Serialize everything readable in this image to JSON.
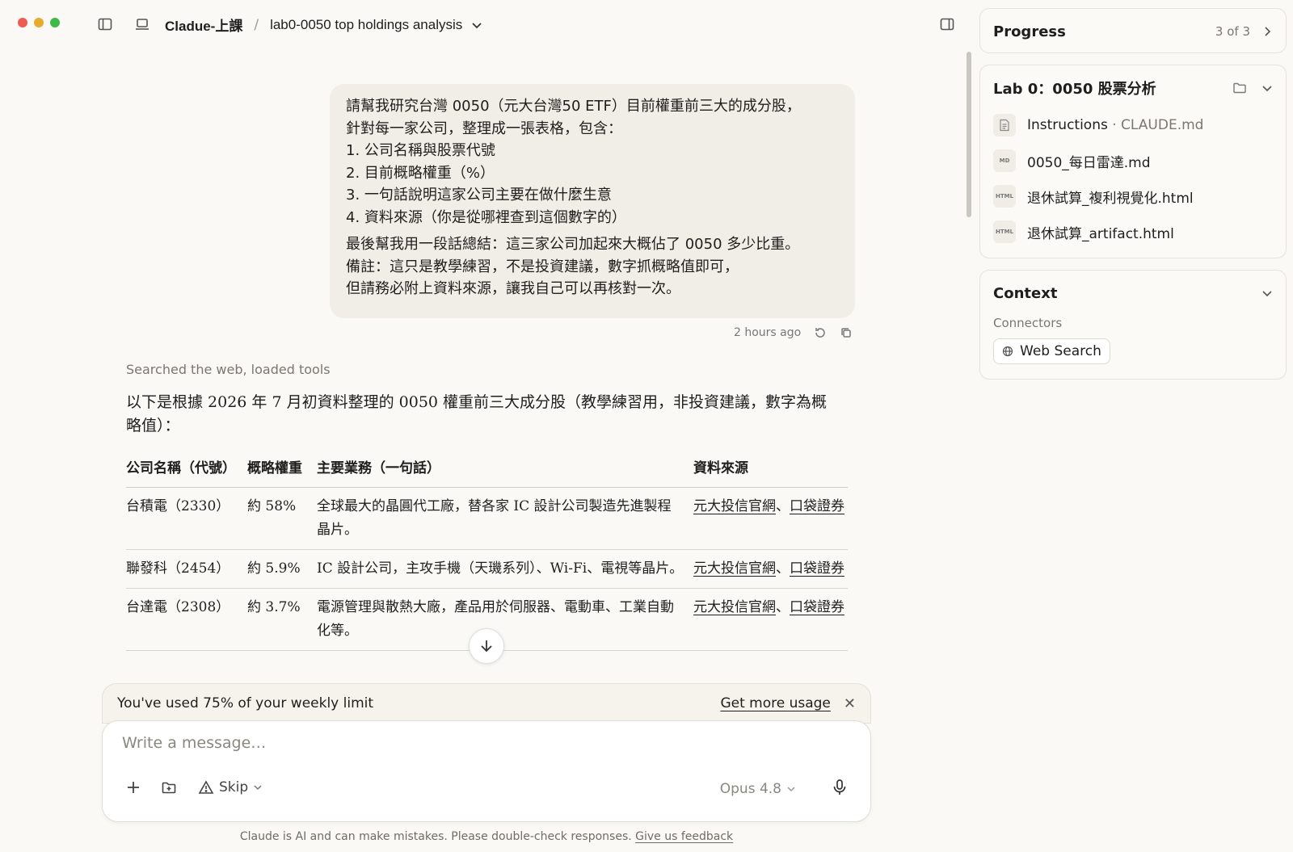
{
  "topbar": {
    "project": "Cladue-上課",
    "separator": "/",
    "chat_title": "lab0-0050 top holdings analysis"
  },
  "user_message": {
    "lines_part1": [
      "請幫我研究台灣 0050（元大台灣50 ETF）目前權重前三大的成分股，",
      "針對每一家公司，整理成一張表格，包含：",
      "1. 公司名稱與股票代號",
      "2. 目前概略權重（%）",
      "3. 一句話說明這家公司主要在做什麼生意",
      "4. 資料來源（你是從哪裡查到這個數字的）"
    ],
    "lines_part2": [
      "最後幫我用一段話總結：這三家公司加起來大概佔了 0050 多少比重。",
      "備註：這只是教學練習，不是投資建議，數字抓概略值即可，",
      "但請務必附上資料來源，讓我自己可以再核對一次。"
    ],
    "timestamp": "2 hours ago"
  },
  "assistant": {
    "tools_line": "Searched the web, loaded tools",
    "intro": "以下是根據 2026 年 7 月初資料整理的 0050 權重前三大成分股（教學練習用，非投資建議，數字為概略值）：",
    "table": {
      "headers": [
        "公司名稱（代號）",
        "概略權重",
        "主要業務（一句話）",
        "資料來源"
      ],
      "rows": [
        {
          "company": "台積電（2330）",
          "weight": "約 58%",
          "business": "全球最大的晶圓代工廠，替各家 IC 設計公司製造先進製程晶片。",
          "source_a": "元大投信官網",
          "source_sep": "、",
          "source_b": "口袋證券"
        },
        {
          "company": "聯發科（2454）",
          "weight": "約 5.9%",
          "business": "IC 設計公司，主攻手機（天璣系列）、Wi-Fi、電視等晶片。",
          "source_a": "元大投信官網",
          "source_sep": "、",
          "source_b": "口袋證券"
        },
        {
          "company": "台達電（2308）",
          "weight": "約 3.7%",
          "business": "電源管理與散熱大廠，產品用於伺服器、電動車、工業自動化等。",
          "source_a": "元大投信官網",
          "source_sep": "、",
          "source_b": "口袋證券"
        }
      ]
    }
  },
  "composer": {
    "usage_text": "You've used 75% of your weekly limit",
    "get_more": "Get more usage",
    "placeholder": "Write a message…",
    "skip_label": "Skip",
    "model": "Opus 4.8"
  },
  "disclaimer": {
    "text": "Claude is AI and can make mistakes. Please double-check responses.",
    "feedback": "Give us feedback"
  },
  "panel": {
    "progress": {
      "title": "Progress",
      "count": "3 of 3"
    },
    "lab": {
      "title": "Lab 0：0050 股票分析",
      "files": [
        {
          "name": "Instructions",
          "suffix": " · CLAUDE.md",
          "icon": "document-icon",
          "badge": ""
        },
        {
          "name": "0050_每日雷達.md",
          "suffix": "",
          "icon": "markdown-file-icon",
          "badge": "MD"
        },
        {
          "name": "退休試算_複利視覺化.html",
          "suffix": "",
          "icon": "html-file-icon",
          "badge": "HTML"
        },
        {
          "name": "退休試算_artifact.html",
          "suffix": "",
          "icon": "html-file-icon",
          "badge": "HTML"
        }
      ]
    },
    "context": {
      "title": "Context",
      "connectors_label": "Connectors",
      "connector": "Web Search"
    }
  }
}
